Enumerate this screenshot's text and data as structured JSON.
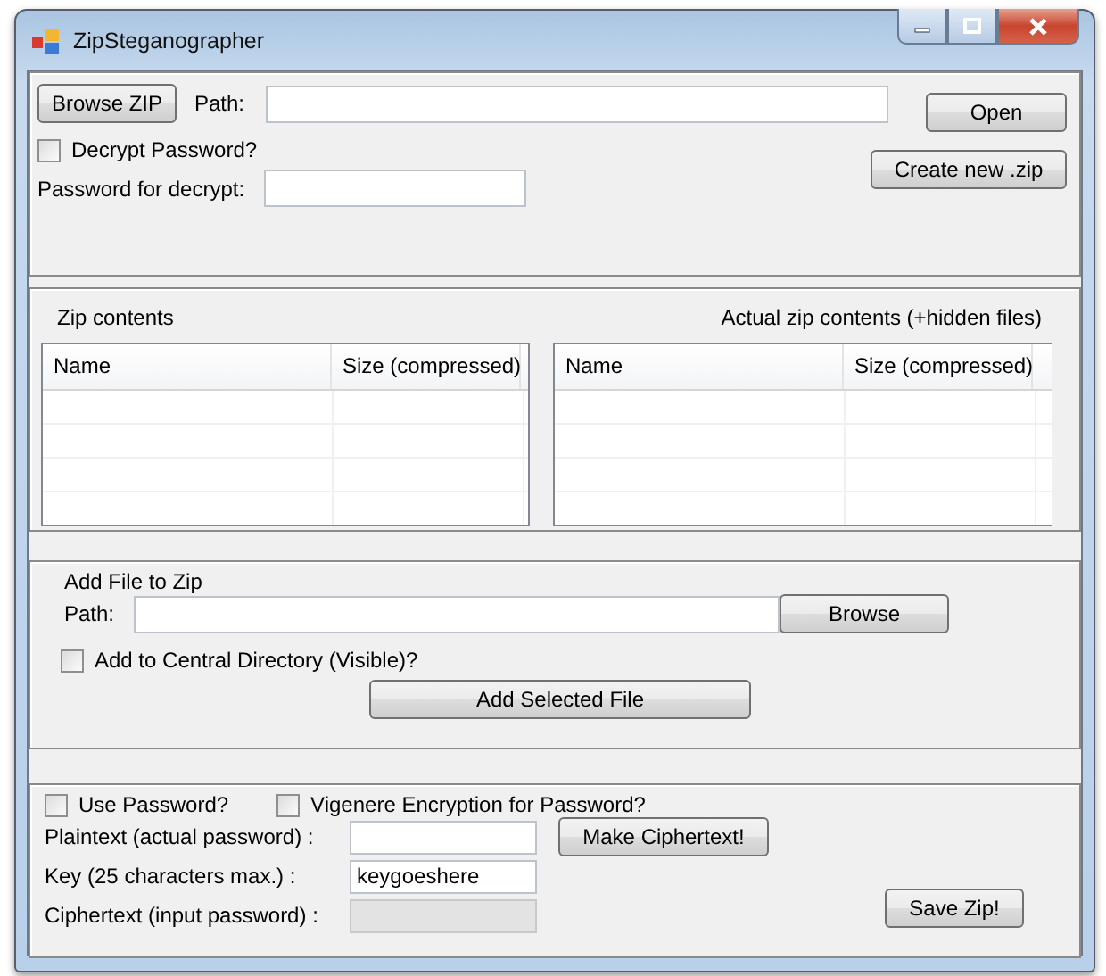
{
  "window": {
    "title": "ZipSteganographer"
  },
  "open_panel": {
    "browse_button": "Browse ZIP",
    "path_label": "Path:",
    "path": {
      "disabled": false
    },
    "open_button": "Open",
    "decrypt_checkbox": {
      "label": "Decrypt Password?",
      "checked": false
    },
    "create_button": "Create new .zip",
    "password_label": "Password for decrypt:",
    "password": {
      "disabled": false
    }
  },
  "lists": [
    {
      "title": "Zip contents",
      "columns": [
        "Name",
        "Size (compressed)"
      ]
    },
    {
      "title": "Actual zip contents (+hidden files)",
      "columns": [
        "Name",
        "Size (compressed)"
      ]
    }
  ],
  "add_panel": {
    "title": "Add File to Zip",
    "path_label": "Path:",
    "path": {
      "disabled": false
    },
    "browse_button": "Browse",
    "central_checkbox": {
      "label": "Add to Central Directory (Visible)?",
      "checked": false
    },
    "add_button": "Add Selected File"
  },
  "save_panel": {
    "checkboxes": [
      {
        "label": "Use Password?",
        "checked": false
      },
      {
        "label": "Vigenere Encryption for Password?",
        "checked": false
      }
    ],
    "fields": [
      {
        "label": "Plaintext (actual password) :",
        "disabled": false
      },
      {
        "label": "Key (25 characters max.) :",
        "value": "keygoeshere",
        "disabled": false
      },
      {
        "label": "Ciphertext (input password) :",
        "disabled": true
      }
    ],
    "cipher_button": "Make Ciphertext!",
    "save_button": "Save Zip!"
  }
}
